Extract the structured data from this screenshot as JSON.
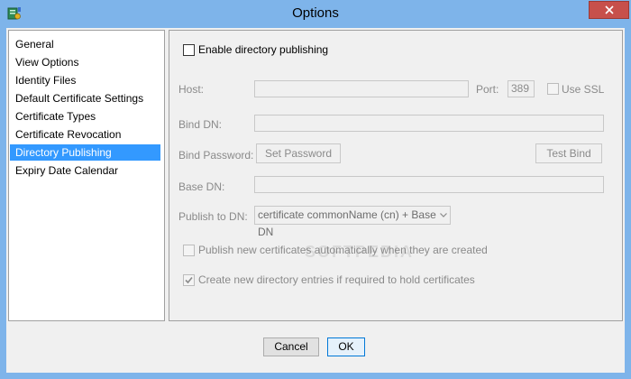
{
  "window": {
    "title": "Options"
  },
  "nav": {
    "items": [
      {
        "label": "General"
      },
      {
        "label": "View Options"
      },
      {
        "label": "Identity Files"
      },
      {
        "label": "Default Certificate Settings"
      },
      {
        "label": "Certificate Types"
      },
      {
        "label": "Certificate Revocation"
      },
      {
        "label": "Directory Publishing",
        "selected": true
      },
      {
        "label": "Expiry Date Calendar"
      }
    ]
  },
  "publishing": {
    "enable_label": "Enable directory publishing",
    "host_label": "Host:",
    "host_value": "",
    "port_label": "Port:",
    "port_value": "389",
    "use_ssl_label": "Use SSL",
    "bind_dn_label": "Bind DN:",
    "bind_dn_value": "",
    "bind_password_label": "Bind Password:",
    "set_password_label": "Set Password",
    "test_bind_label": "Test Bind",
    "base_dn_label": "Base DN:",
    "base_dn_value": "",
    "publish_to_dn_label": "Publish to DN:",
    "publish_to_dn_value": "certificate commonName (cn) + Base DN",
    "publish_auto_label": "Publish new certificates automatically when they are created",
    "create_entries_label": "Create new directory entries if required to hold certificates"
  },
  "footer": {
    "cancel_label": "Cancel",
    "ok_label": "OK"
  },
  "colors": {
    "title_bar": "#7eb4ea",
    "selection": "#3399ff",
    "close_button": "#c7504b"
  },
  "icons": {
    "app": "certificate-app-icon",
    "close": "close-icon",
    "checkmark": "checkmark-icon",
    "dropdown": "chevron-down-icon"
  }
}
